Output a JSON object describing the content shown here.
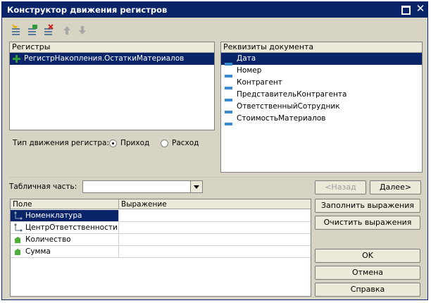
{
  "window": {
    "title": "Конструктор движения регистров"
  },
  "toolbar": {
    "tools": [
      {
        "icon": "add-register-icon"
      },
      {
        "icon": "edit-register-icon"
      },
      {
        "icon": "delete-register-icon"
      },
      {
        "icon": "arrow-up-icon"
      },
      {
        "icon": "arrow-down-icon"
      }
    ]
  },
  "registers": {
    "header": "Регистры",
    "items": [
      {
        "label": "РегистрНакопления.ОстаткиМатериалов",
        "icon": "plus-icon",
        "selected": true
      }
    ]
  },
  "movement_type": {
    "label": "Тип движения регистра:",
    "options": [
      {
        "label": "Приход",
        "checked": true
      },
      {
        "label": "Расход",
        "checked": false
      }
    ]
  },
  "document_attributes": {
    "header": "Реквизиты документа",
    "items": [
      {
        "label": "Дата",
        "selected": true
      },
      {
        "label": "Номер"
      },
      {
        "label": "Контрагент"
      },
      {
        "label": "ПредставительКонтрагента"
      },
      {
        "label": "ОтветственныйСотрудник"
      },
      {
        "label": "СтоимостьМатериалов"
      }
    ]
  },
  "tabular_part": {
    "label": "Табличная часть:",
    "value": ""
  },
  "nav": {
    "back": "<Назад",
    "next": "Далее>"
  },
  "grid": {
    "columns": [
      "Поле",
      "Выражение"
    ],
    "rows": [
      {
        "field": "Номенклатура",
        "icon": "dimension-icon",
        "expression": "",
        "selected": true
      },
      {
        "field": "ЦентрОтветственности",
        "icon": "dimension-icon",
        "expression": ""
      },
      {
        "field": "Количество",
        "icon": "resource-icon",
        "expression": ""
      },
      {
        "field": "Сумма",
        "icon": "resource-icon",
        "expression": ""
      }
    ]
  },
  "actions": {
    "fill": "Заполнить выражения",
    "clear": "Очистить выражения",
    "ok": "OK",
    "cancel": "Отмена",
    "help": "Справка"
  },
  "colors": {
    "title_bar": "#0a246a",
    "selection": "#0a246a",
    "dialog_bg": "#d8d4c4"
  }
}
